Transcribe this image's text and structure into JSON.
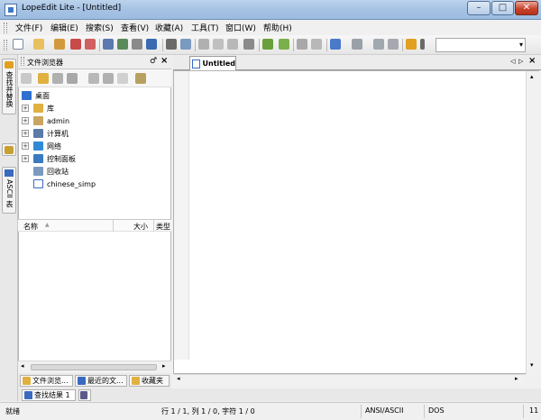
{
  "window": {
    "title": "LopeEdit Lite - [Untitled]",
    "minimize_glyph": "–",
    "maximize_glyph": "□",
    "close_glyph": "✕"
  },
  "menu": {
    "items": [
      "文件(F)",
      "编辑(E)",
      "搜索(S)",
      "查看(V)",
      "收藏(A)",
      "工具(T)",
      "窗口(W)",
      "帮助(H)"
    ]
  },
  "toolbar": {
    "search_combo_value": ""
  },
  "left_strip": {
    "find_replace_tab": "查找并替换",
    "ascii_tab": "ASCII 表"
  },
  "file_browser": {
    "title": "文件浏览器",
    "pin_glyph": "♂",
    "close_glyph": "×",
    "tree": [
      {
        "label": "桌面",
        "expander": "",
        "icon_color": "#2f6fd0"
      },
      {
        "label": "库",
        "expander": "+",
        "icon_color": "#e0b040"
      },
      {
        "label": "admin",
        "expander": "+",
        "icon_color": "#caa560"
      },
      {
        "label": "计算机",
        "expander": "+",
        "icon_color": "#5a7aa8"
      },
      {
        "label": "网络",
        "expander": "+",
        "icon_color": "#2f8ad8"
      },
      {
        "label": "控制面板",
        "expander": "+",
        "icon_color": "#3a7ac0"
      },
      {
        "label": "回收站",
        "expander": "",
        "icon_color": "#7a9ac0"
      },
      {
        "label": "chinese_simp",
        "expander": "",
        "icon_color": "#3a6ac0"
      }
    ],
    "list_columns": [
      "名称",
      "大小",
      "类型"
    ],
    "sort_glyph": "▲"
  },
  "bottom_tabs": {
    "tab1": "文件浏览...",
    "tab2": "最近的文...",
    "tab3": "收藏夹"
  },
  "find_results": {
    "label": "查找结果 1"
  },
  "editor": {
    "tab_label": "Untitled",
    "nav_left": "◁",
    "nav_right": "▷",
    "close_glyph": "×"
  },
  "status": {
    "state": "就绪",
    "position": "行 1 / 1, 列 1 / 0, 字符 1 / 0",
    "encoding": "ANSI/ASCII",
    "line_ending": "DOS",
    "extra": "11"
  }
}
